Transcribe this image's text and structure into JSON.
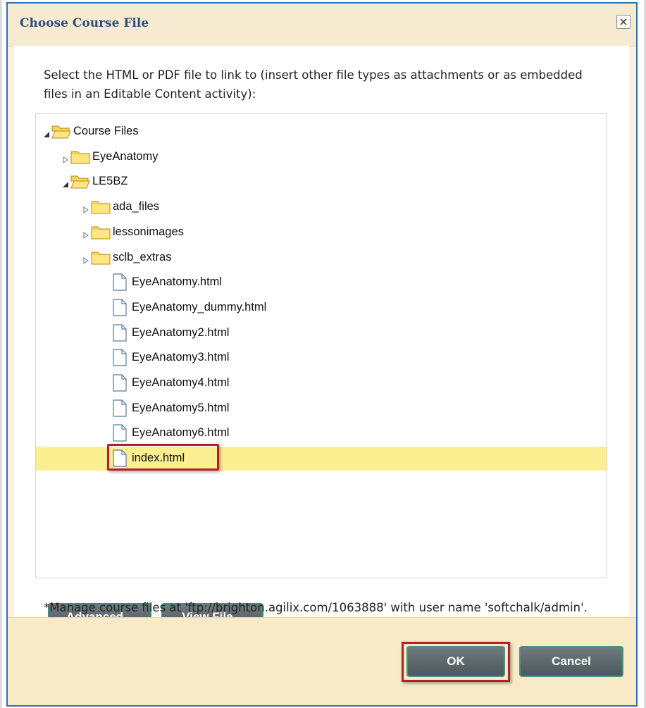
{
  "dialog": {
    "title": "Choose Course File",
    "close_label": "×",
    "instructions": "Select the HTML or PDF file to link to (insert other file types as attachments or as embedded files in an Editable Content activity):",
    "tree": [
      {
        "label": "Course Files",
        "type": "folder",
        "depth": 0,
        "expanded": true
      },
      {
        "label": "EyeAnatomy",
        "type": "folder",
        "depth": 1,
        "expanded": false
      },
      {
        "label": "LE5BZ",
        "type": "folder",
        "depth": 1,
        "expanded": true
      },
      {
        "label": "ada_files",
        "type": "folder",
        "depth": 2,
        "expanded": false
      },
      {
        "label": "lessonimages",
        "type": "folder",
        "depth": 2,
        "expanded": false
      },
      {
        "label": "sclb_extras",
        "type": "folder",
        "depth": 2,
        "expanded": false
      },
      {
        "label": "EyeAnatomy.html",
        "type": "file",
        "depth": 2
      },
      {
        "label": "EyeAnatomy_dummy.html",
        "type": "file",
        "depth": 2
      },
      {
        "label": "EyeAnatomy2.html",
        "type": "file",
        "depth": 2
      },
      {
        "label": "EyeAnatomy3.html",
        "type": "file",
        "depth": 2
      },
      {
        "label": "EyeAnatomy4.html",
        "type": "file",
        "depth": 2
      },
      {
        "label": "EyeAnatomy5.html",
        "type": "file",
        "depth": 2
      },
      {
        "label": "EyeAnatomy6.html",
        "type": "file",
        "depth": 2
      },
      {
        "label": "index.html",
        "type": "file",
        "depth": 2,
        "selected": true
      }
    ],
    "buttons": {
      "advanced": "Advanced...",
      "view_file": "View File...",
      "ok": "OK",
      "cancel": "Cancel"
    },
    "footer_note": "*Manage course files at 'ftp://brighton.agilix.com/1063888' with user name 'softchalk/admin'.",
    "colors": {
      "title_text": "#2a4f7d",
      "dialog_border": "#2f6fb5",
      "selected_row": "#fcef92",
      "highlight_outline": "#b4202a",
      "button_bg": "#5c686c"
    }
  }
}
